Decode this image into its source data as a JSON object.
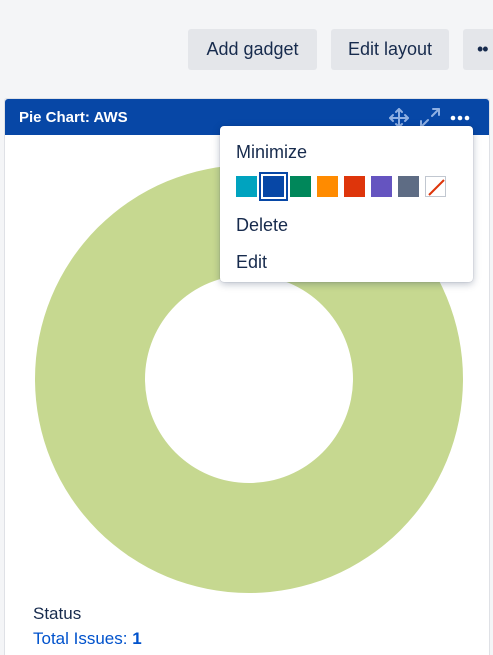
{
  "toolbar": {
    "add_gadget_label": "Add gadget",
    "edit_layout_label": "Edit layout",
    "more_label": "••"
  },
  "gadget": {
    "title": "Pie Chart: AWS",
    "header_color": "#0747a6",
    "icons": [
      "move-icon",
      "expand-icon",
      "more-actions-icon"
    ],
    "status_label": "Status",
    "total_issues_label": "Total Issues:",
    "total_issues_count": "1"
  },
  "chart_data": {
    "type": "pie",
    "donut": true,
    "series": [
      {
        "value": 1,
        "color": "#c6d890"
      }
    ]
  },
  "menu": {
    "minimize_label": "Minimize",
    "delete_label": "Delete",
    "edit_label": "Edit",
    "swatches": [
      {
        "name": "teal",
        "color": "#00a3bf"
      },
      {
        "name": "blue",
        "color": "#0747a6",
        "selected": true
      },
      {
        "name": "green",
        "color": "#00875a"
      },
      {
        "name": "orange",
        "color": "#ff8b00"
      },
      {
        "name": "red",
        "color": "#de350b"
      },
      {
        "name": "purple",
        "color": "#6554c0"
      },
      {
        "name": "grey",
        "color": "#5e6c84"
      },
      {
        "name": "none",
        "color": "#ffffff"
      }
    ]
  }
}
